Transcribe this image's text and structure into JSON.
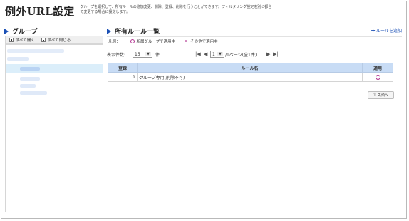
{
  "header": {
    "title": "例外URL設定",
    "description": "グループを選択して、所有ルールの追加変更、削除、登録、削除を行うことができます。フィルタリング設定を別に都合で変更する場合に設定します。"
  },
  "group_panel": {
    "title": "グループ",
    "expand_all_label": "すべて開く",
    "collapse_all_label": "すべて閉じる",
    "selected_item_color": "#dbeefa",
    "tree_item_color": "#cfe0f7"
  },
  "rules_panel": {
    "title": "所有ルール一覧",
    "add_rule_label": "ルールを追加",
    "legend": {
      "label": "凡例：",
      "item1": "所属グループで適用中",
      "item2": "その他で適用中"
    },
    "rows_per_page": {
      "label": "表示件数:",
      "value": "15",
      "unit": "件"
    },
    "pager": {
      "page_value": "1",
      "page_text": "/1ページ(全1件)"
    },
    "table": {
      "headers": {
        "registration": "登録",
        "rule_name": "ルール名",
        "apply": "適用"
      },
      "rows": [
        {
          "number": "1",
          "rule_name": "グループ専用(削除不可)"
        }
      ]
    },
    "back_to_top_label": "先頭へ"
  },
  "colors": {
    "accent": "#1a4fb5",
    "apply_circle": "#b0308e",
    "table_header": "#c8dcf5"
  }
}
